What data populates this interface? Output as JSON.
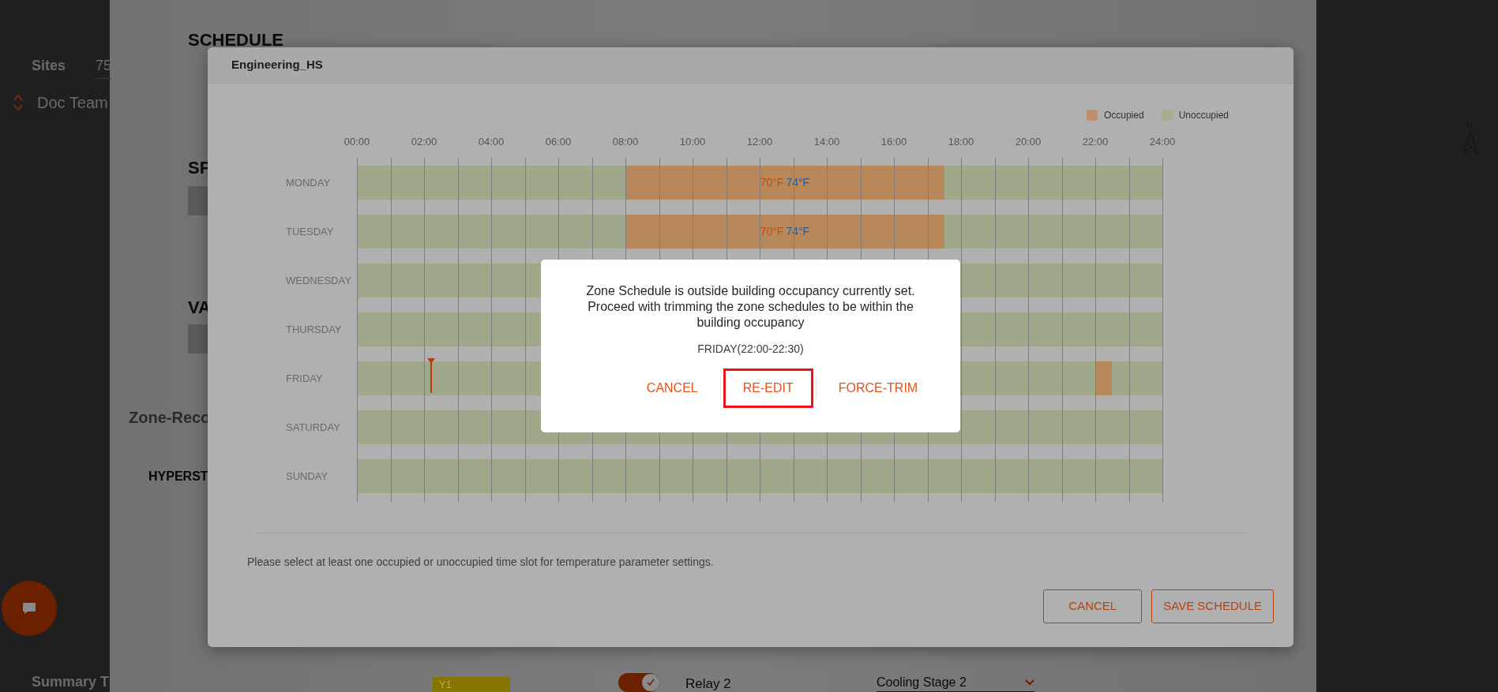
{
  "background_page": {
    "sites_label": "Sites",
    "sites_value": "75",
    "site_name": "Doc Team",
    "section_title": "SCHEDULE",
    "section_2": "SP",
    "section_3": "VA",
    "zone_title": "Zone-Reco",
    "equipment_title": "HYPERST",
    "summary_title": "Summary T",
    "stage_tag": "Y1",
    "relay": {
      "label": "Relay 2",
      "on": true
    },
    "relay_mode": "Cooling Stage 2"
  },
  "schedule_modal": {
    "title": "Engineering_HS",
    "legend": [
      {
        "label": "Occupied",
        "kind": "occupied"
      },
      {
        "label": "Unoccupied",
        "kind": "unoccupied"
      }
    ],
    "time_ticks": [
      "00:00",
      "02:00",
      "04:00",
      "06:00",
      "08:00",
      "10:00",
      "12:00",
      "14:00",
      "16:00",
      "18:00",
      "20:00",
      "22:00",
      "24:00"
    ],
    "days": [
      {
        "name": "MONDAY",
        "slots": [
          {
            "kind": "occupied",
            "heating": "70°F",
            "cooling": "74°F"
          }
        ]
      },
      {
        "name": "TUESDAY",
        "slots": [
          {
            "kind": "occupied",
            "heating": "70°F",
            "cooling": "74°F"
          }
        ]
      },
      {
        "name": "WEDNESDAY"
      },
      {
        "name": "THURSDAY"
      },
      {
        "name": "FRIDAY",
        "slots": [
          {
            "kind": "occupied"
          }
        ]
      },
      {
        "name": "SATURDAY"
      },
      {
        "name": "SUNDAY"
      }
    ],
    "hint": "Please select at least one occupied or unoccupied time slot for temperature parameter settings.",
    "buttons": [
      "CANCEL",
      "SAVE SCHEDULE"
    ]
  },
  "confirm_dialog": {
    "message": "Zone Schedule is outside building occupancy currently set. Proceed with trimming the zone schedules to be within the building occupancy",
    "detail": "FRIDAY(22:00-22:30)",
    "buttons": [
      {
        "label": "CANCEL",
        "focused": false
      },
      {
        "label": "RE-EDIT",
        "focused": true
      },
      {
        "label": "FORCE-TRIM",
        "focused": false
      }
    ]
  }
}
